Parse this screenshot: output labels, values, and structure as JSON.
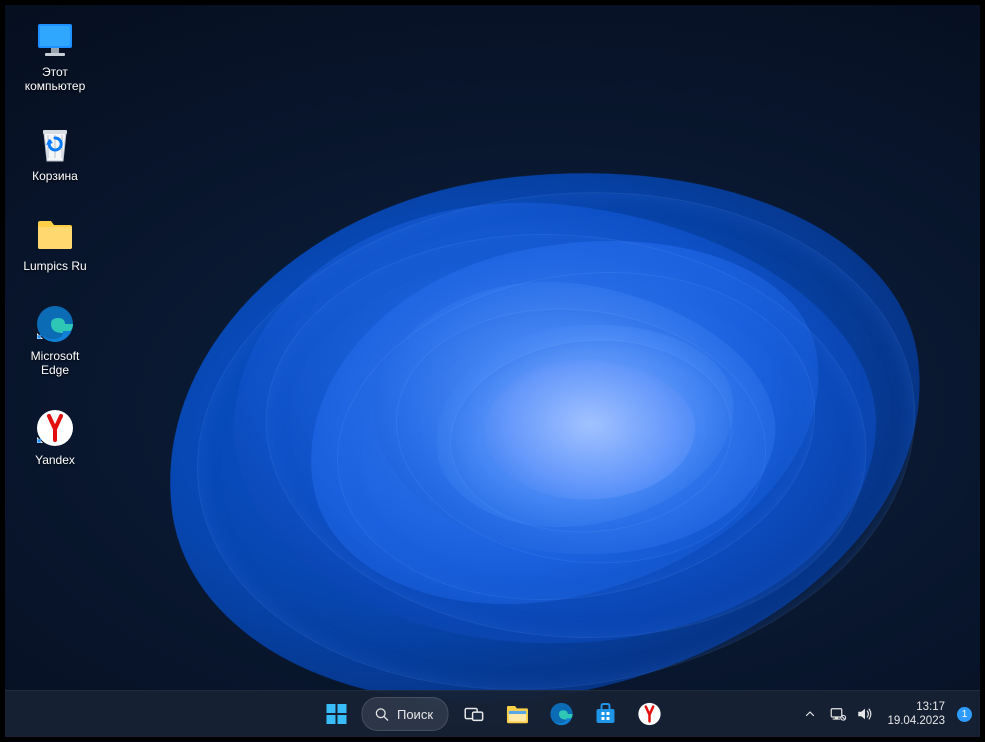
{
  "desktop_icons": [
    {
      "id": "this-pc",
      "label": "Этот\nкомпьютер"
    },
    {
      "id": "recycle-bin",
      "label": "Корзина"
    },
    {
      "id": "lumpics-folder",
      "label": "Lumpics Ru"
    },
    {
      "id": "edge",
      "label": "Microsoft\nEdge"
    },
    {
      "id": "yandex",
      "label": "Yandex"
    }
  ],
  "taskbar": {
    "search_label": "Поиск",
    "pinned": [
      {
        "id": "start",
        "name": "start-button"
      },
      {
        "id": "search",
        "name": "search-button"
      },
      {
        "id": "task-view",
        "name": "task-view-button"
      },
      {
        "id": "explorer",
        "name": "file-explorer-button"
      },
      {
        "id": "edge",
        "name": "edge-button"
      },
      {
        "id": "store",
        "name": "microsoft-store-button"
      },
      {
        "id": "yandex",
        "name": "yandex-button"
      }
    ]
  },
  "systray": {
    "time": "13:17",
    "date": "19.04.2023",
    "notification_count": "1"
  }
}
